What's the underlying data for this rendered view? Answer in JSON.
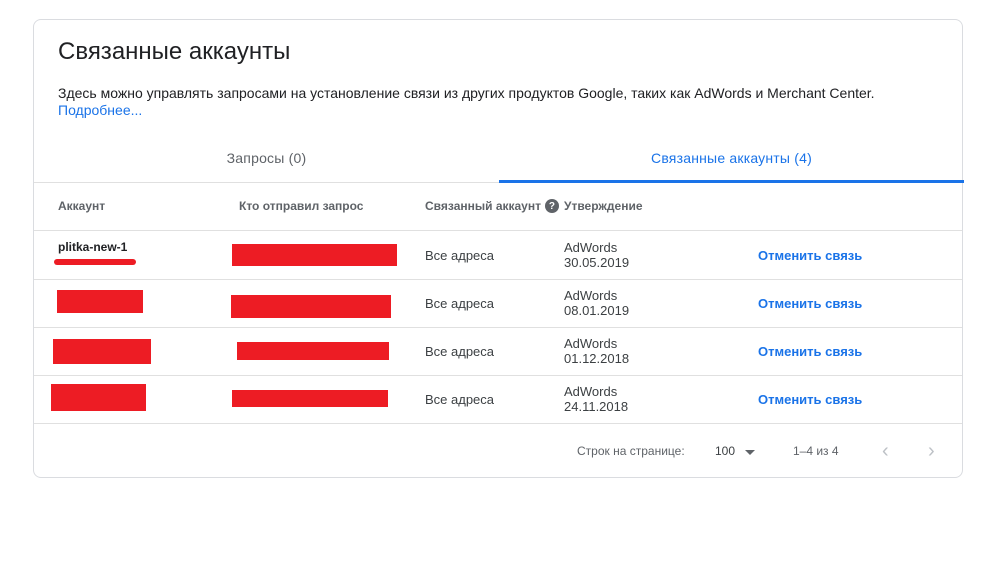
{
  "page": {
    "title": "Связанные аккаунты",
    "description": "Здесь можно управлять запросами на установление связи из других продуктов Google, таких как AdWords и Merchant Center.",
    "learn_more": "Подробнее..."
  },
  "tabs": [
    {
      "label": "Запросы (0)",
      "active": false
    },
    {
      "label": "Связанные аккаунты (4)",
      "active": true
    }
  ],
  "table": {
    "headers": {
      "account": "Аккаунт",
      "requester": "Кто отправил запрос",
      "linked": "Связанный аккаунт",
      "approval": "Утверждение"
    },
    "rows": [
      {
        "account": "plitka-new-1",
        "linked": "Все адреса",
        "approval_product": "AdWords",
        "approval_date": "30.05.2019",
        "action": "Отменить связь"
      },
      {
        "account": "",
        "linked": "Все адреса",
        "approval_product": "AdWords",
        "approval_date": "08.01.2019",
        "action": "Отменить связь"
      },
      {
        "account": "",
        "linked": "Все адреса",
        "approval_product": "AdWords",
        "approval_date": "01.12.2018",
        "action": "Отменить связь"
      },
      {
        "account": "",
        "linked": "Все адреса",
        "approval_product": "AdWords",
        "approval_date": "24.11.2018",
        "action": "Отменить связь"
      }
    ]
  },
  "pagination": {
    "rows_per_page_label": "Строк на странице:",
    "rows_per_page_value": "100",
    "range": "1–4 из 4"
  },
  "colors": {
    "accent": "#1a73e8",
    "redaction": "#ed1c24"
  },
  "icons": {
    "help": "help-circle-icon",
    "dropdown": "chevron-down-icon",
    "prev": "chevron-left-icon",
    "next": "chevron-right-icon"
  }
}
